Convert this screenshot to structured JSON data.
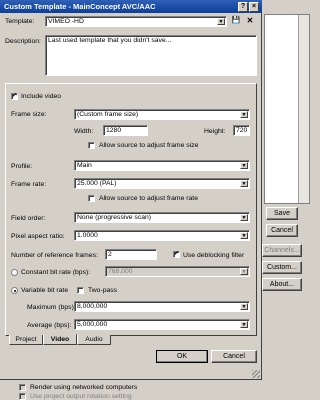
{
  "window": {
    "title": "Custom Template - MainConcept AVC/AAC",
    "help_glyph": "?",
    "close_glyph": "×"
  },
  "template": {
    "label": "Template:",
    "value": "VIMEO -HD",
    "save_glyph": "💾",
    "delete_glyph": "✕"
  },
  "description": {
    "label": "Description:",
    "value": "Last used template that you didn't save..."
  },
  "video": {
    "include_label": "Include video",
    "include_checked": true,
    "frame_size_label": "Frame size:",
    "frame_size_value": "(Custom frame size)",
    "width_label": "Width:",
    "width_value": "1280",
    "height_label": "Height:",
    "height_value": "720",
    "allow_frame_size_label": "Allow source to adjust frame size",
    "profile_label": "Profile:",
    "profile_value": "Main",
    "frame_rate_label": "Frame rate:",
    "frame_rate_value": "25.000 (PAL)",
    "allow_frame_rate_label": "Allow source to adjust frame rate",
    "field_order_label": "Field order:",
    "field_order_value": "None (progressive scan)",
    "pixel_aspect_label": "Pixel aspect ratio:",
    "pixel_aspect_value": "1.0000",
    "ref_frames_label": "Number of reference frames:",
    "ref_frames_value": "2",
    "deblocking_label": "Use deblocking filter",
    "deblocking_checked": true,
    "cbr_label": "Constant bit rate (bps):",
    "cbr_value": "768,000",
    "vbr_label": "Variable bit rate",
    "twopass_label": "Two-pass",
    "max_label": "Maximum (bps):",
    "max_value": "8,000,000",
    "avg_label": "Average (bps):",
    "avg_value": "5,000,000"
  },
  "tabs": [
    "Project",
    "Video",
    "Audio"
  ],
  "buttons": {
    "ok": "OK",
    "cancel": "Cancel"
  },
  "right_panel": {
    "save": "Save",
    "cancel": "Cancel",
    "channels": "Channels...",
    "custom": "Custom...",
    "about": "About..."
  },
  "bottom": {
    "networked_label": "Render using networked computers",
    "rotation_label": "Use project output rotation setting"
  }
}
